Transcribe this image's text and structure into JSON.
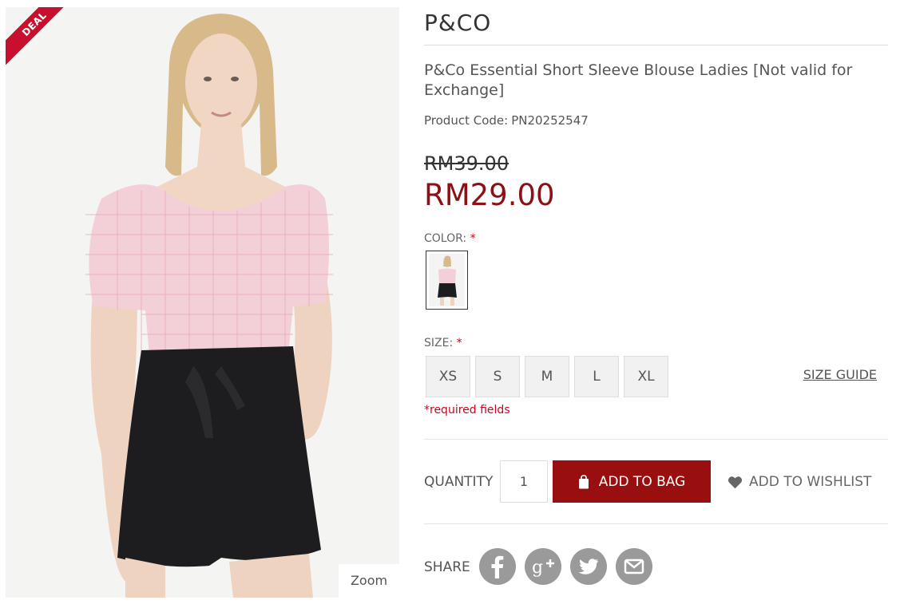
{
  "image": {
    "badge": "DEAL",
    "zoom_label": "Zoom"
  },
  "product": {
    "brand": "P&CO",
    "title": "P&Co Essential Short Sleeve Blouse Ladies [Not valid for Exchange]",
    "code_label": "Product Code:",
    "code": "PN20252547",
    "old_price": "RM39.00",
    "price": "RM29.00"
  },
  "color": {
    "label": "COLOR:",
    "required_mark": "*"
  },
  "size": {
    "label": "SIZE:",
    "required_mark": "*",
    "options": [
      "XS",
      "S",
      "M",
      "L",
      "XL"
    ],
    "guide_label": "SIZE GUIDE"
  },
  "required_note": "*required fields",
  "purchase": {
    "quantity_label": "QUANTITY",
    "quantity_value": "1",
    "add_to_bag_label": "ADD TO BAG",
    "wishlist_label": "ADD TO WISHLIST"
  },
  "share": {
    "label": "SHARE",
    "icons": [
      "facebook-icon",
      "google-plus-icon",
      "twitter-icon",
      "email-icon"
    ]
  },
  "colors": {
    "price": "#8b1116",
    "button": "#990f0f",
    "required": "#d0021b",
    "deal_badge": "#c8102e",
    "share_icon": "#9a9a9a"
  }
}
